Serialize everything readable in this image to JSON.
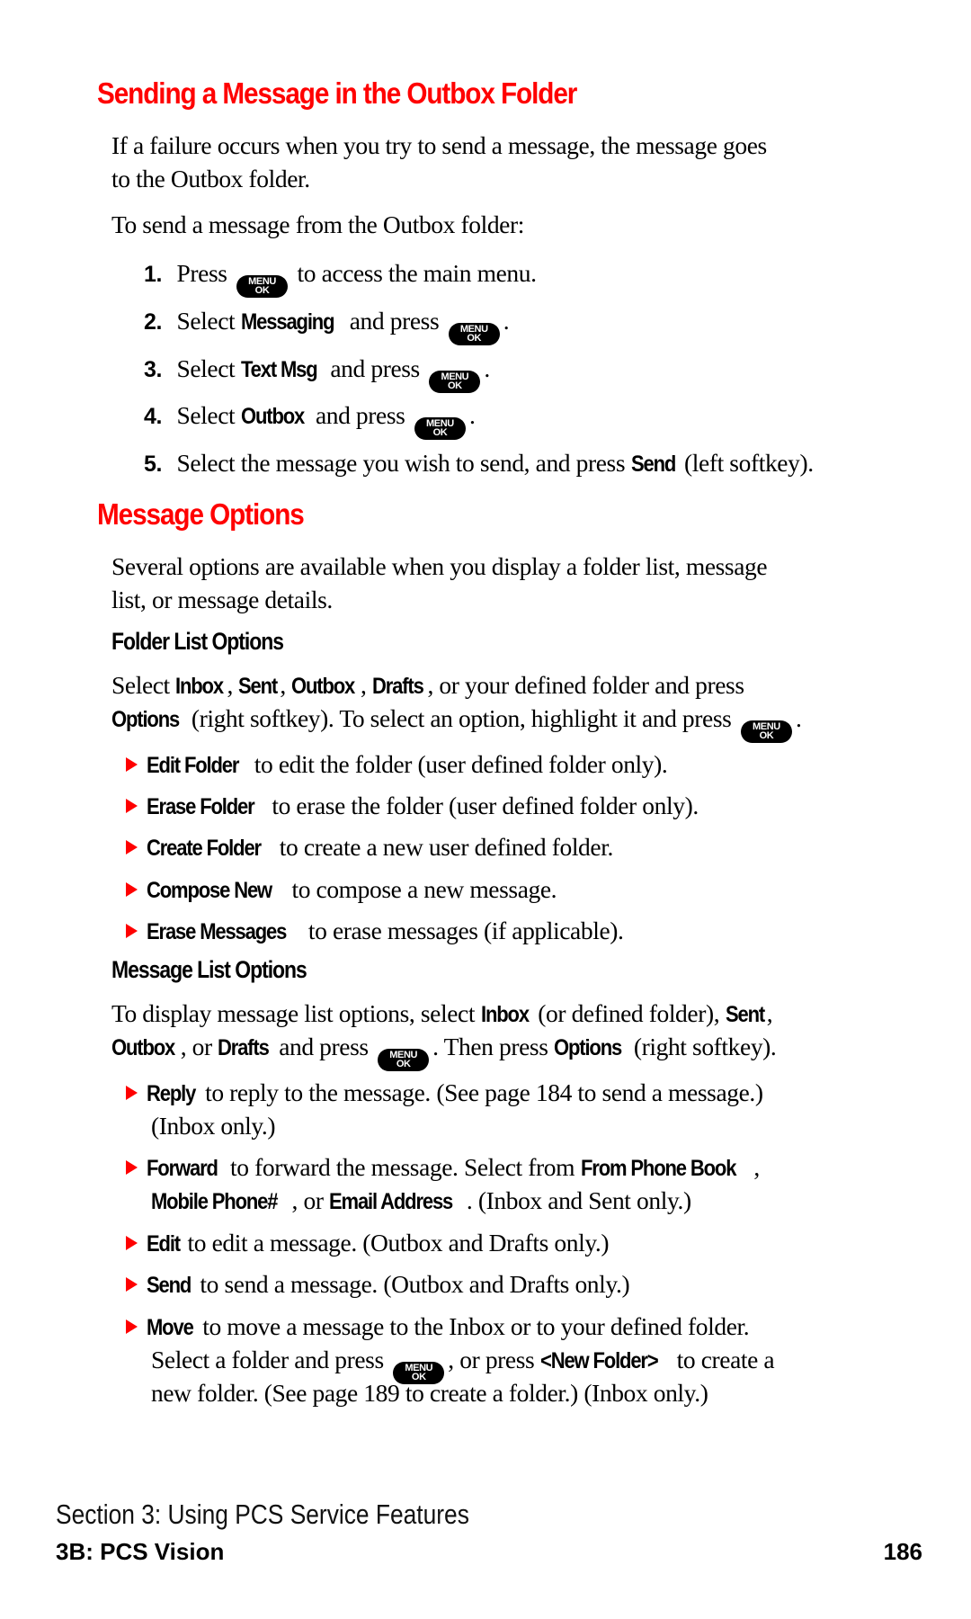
{
  "section1": {
    "title": "Sending a Message in the Outbox Folder",
    "intro_line1": "If a failure occurs when you try to send a message, the message goes",
    "intro_line2": "to the Outbox folder.",
    "lead": "To send a message from the Outbox folder:",
    "menu_key": {
      "top": "MENU",
      "bottom": "OK",
      "icon": "menu-ok-key-icon"
    },
    "steps": [
      {
        "num": "1.",
        "pre": "Press",
        "post": "to access the main menu."
      },
      {
        "num": "2.",
        "pre": "Select",
        "bold": "Messaging",
        "mid": "and press",
        "post": "."
      },
      {
        "num": "3.",
        "pre": "Select",
        "bold": "Text Msg",
        "mid": "and press",
        "post": "."
      },
      {
        "num": "4.",
        "pre": "Select",
        "bold": "Outbox",
        "mid": "and press",
        "post": "."
      },
      {
        "num": "5.",
        "pre": "Select the message you wish to send, and press",
        "bold": "Send",
        "post": "(left softkey)."
      }
    ]
  },
  "section2": {
    "title": "Message Options",
    "intro_line1": "Several options are available when you display a folder list, message",
    "intro_line2": "list, or message details.",
    "folder_list": {
      "heading": "Folder List Options",
      "line1": {
        "pre": "Select",
        "b1": "Inbox",
        "b2": "Sent",
        "b3": "Outbox",
        "b4": "Drafts",
        "post": ", or your defined folder and press"
      },
      "line2": {
        "b": "Options",
        "post": "(right softkey). To select an option, highlight it and press",
        "end": "."
      },
      "items": [
        {
          "bold": "Edit Folder",
          "text": "to edit the folder (user defined folder only)."
        },
        {
          "bold": "Erase Folder",
          "text": "to erase the folder (user defined folder only)."
        },
        {
          "bold": "Create Folder",
          "text": "to create a new user defined folder."
        },
        {
          "bold": "Compose New",
          "text": "to compose a new message."
        },
        {
          "bold": "Erase Messages",
          "text": "to erase messages (if applicable)."
        }
      ]
    },
    "message_list": {
      "heading": "Message List Options",
      "line1": {
        "pre": "To display message list options, select",
        "b1": "Inbox",
        "mid": "(or defined folder),",
        "b2": "Sent",
        "end": ","
      },
      "line2": {
        "b1": "Outbox",
        "mid1": ", or",
        "b2": "Drafts",
        "mid2": "and press",
        "mid3": ". Then press",
        "b3": "Options",
        "post": "(right softkey)."
      },
      "reply": {
        "bold": "Reply",
        "text": "to reply to the message. (See page 184 to send a message.)",
        "text2": "(Inbox only.)"
      },
      "forward": {
        "bold": "Forward",
        "text": "to forward the message. Select from",
        "b2": "From Phone Book",
        "c": ",",
        "b3": "Mobile Phone#",
        "or": ", or",
        "b4": "Email Address",
        "end": ". (Inbox and Sent only.)"
      },
      "edit": {
        "bold": "Edit",
        "text": "to edit a message. (Outbox and Drafts only.)"
      },
      "send": {
        "bold": "Send",
        "text": "to send a message. (Outbox and Drafts only.)"
      },
      "move": {
        "bold": "Move",
        "text": "to move a message to the Inbox or to your defined folder.",
        "line2_pre": "Select a folder and press",
        "line2_mid": ", or press",
        "line2_b": "<New Folder>",
        "line2_post": "to create a",
        "line3": "new folder. (See page 189 to create a folder.) (Inbox only.)"
      }
    }
  },
  "footer": {
    "section": "Section 3: Using PCS Service Features",
    "subsection": "3B: PCS Vision",
    "page_number": "186"
  },
  "colors": {
    "heading": "#ff0000",
    "bullet": "#ff0000",
    "text": "#000000"
  }
}
